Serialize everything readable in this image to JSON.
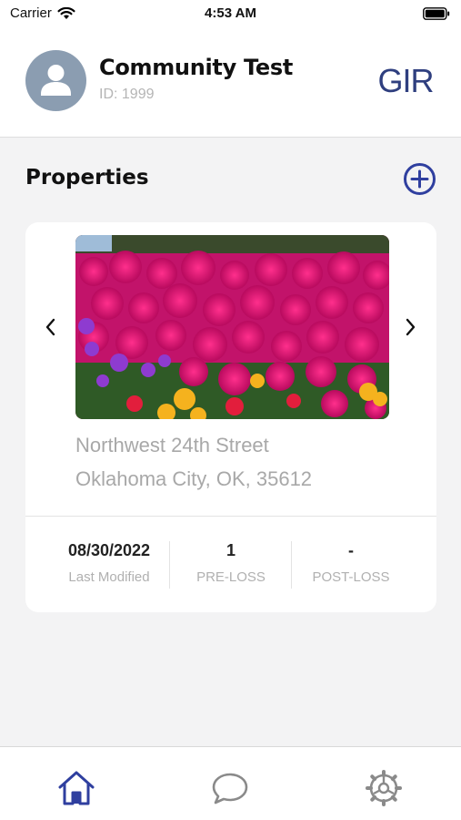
{
  "status_bar": {
    "carrier": "Carrier",
    "time": "4:53 AM"
  },
  "header": {
    "community_name": "Community Test",
    "community_id": "ID: 1999",
    "logo_text": "GIR"
  },
  "properties": {
    "title": "Properties",
    "add_icon": "plus-circle-icon",
    "items": [
      {
        "address_line1": "Northwest 24th Street",
        "address_line2": "Oklahoma City, OK, 35612",
        "photo": "flower-field-photo",
        "stats": [
          {
            "value": "08/30/2022",
            "label": "Last Modified"
          },
          {
            "value": "1",
            "label": "PRE-LOSS"
          },
          {
            "value": "-",
            "label": "POST-LOSS"
          }
        ]
      }
    ]
  },
  "tab_bar": {
    "tabs": [
      {
        "icon": "home-icon",
        "active": true
      },
      {
        "icon": "chat-icon",
        "active": false
      },
      {
        "icon": "settings-icon",
        "active": false
      }
    ]
  },
  "colors": {
    "accent": "#2f3f9f",
    "inactive_icon": "#8a8a8a",
    "background": "#f3f3f4",
    "avatar_bg": "#8b9db1"
  }
}
